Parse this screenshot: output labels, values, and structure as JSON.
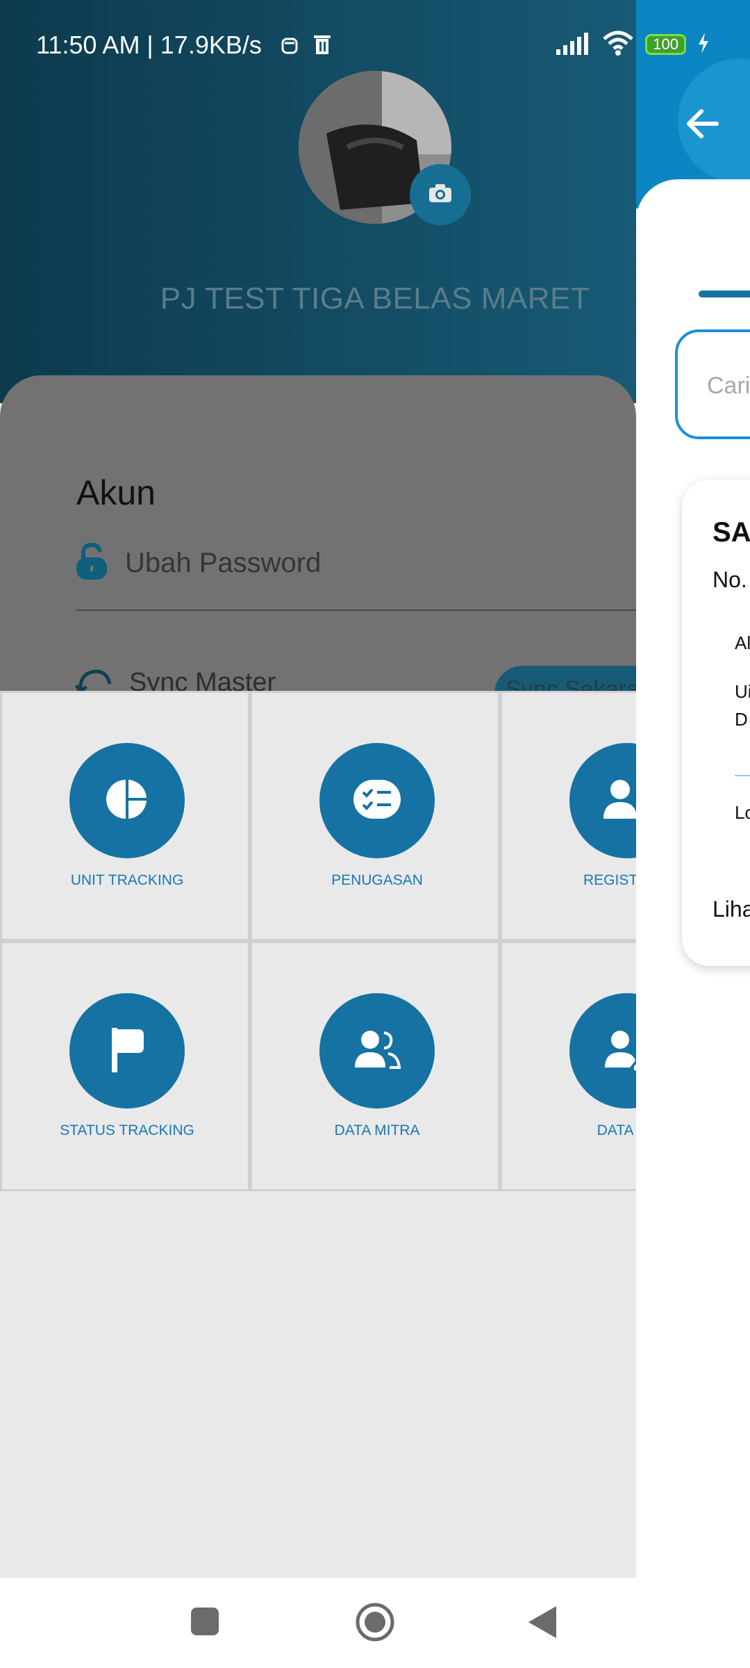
{
  "status_bar": {
    "time_speed": "11:50 AM | 17.9KB/s",
    "battery": "100"
  },
  "profile": {
    "name": "PJ TEST TIGA BELAS MARET"
  },
  "account": {
    "title": "Akun",
    "change_password": "Ubah Password",
    "sync_master": "Sync Master",
    "sync_now": "Sync Sekara"
  },
  "menu": {
    "items": [
      {
        "label": "UNIT TRACKING",
        "icon": "pie-chart-icon"
      },
      {
        "label": "PENUGASAN",
        "icon": "checklist-icon"
      },
      {
        "label": "REGISTER A",
        "icon": "user-add-icon"
      },
      {
        "label": "STATUS TRACKING",
        "icon": "flag-icon"
      },
      {
        "label": "DATA MITRA",
        "icon": "users-icon"
      },
      {
        "label": "DATA PR",
        "icon": "user-edit-icon"
      }
    ]
  },
  "right_panel": {
    "search_placeholder": "Cari",
    "card": {
      "title": "SA",
      "no": "No.",
      "line1": "Al",
      "line2a": "Ui",
      "line2b": "D",
      "line3": "Lo",
      "link": "Liha"
    }
  },
  "colors": {
    "primary": "#1572a3",
    "header_dark": "#0d3a4d",
    "accent_blue": "#0a86c2"
  }
}
